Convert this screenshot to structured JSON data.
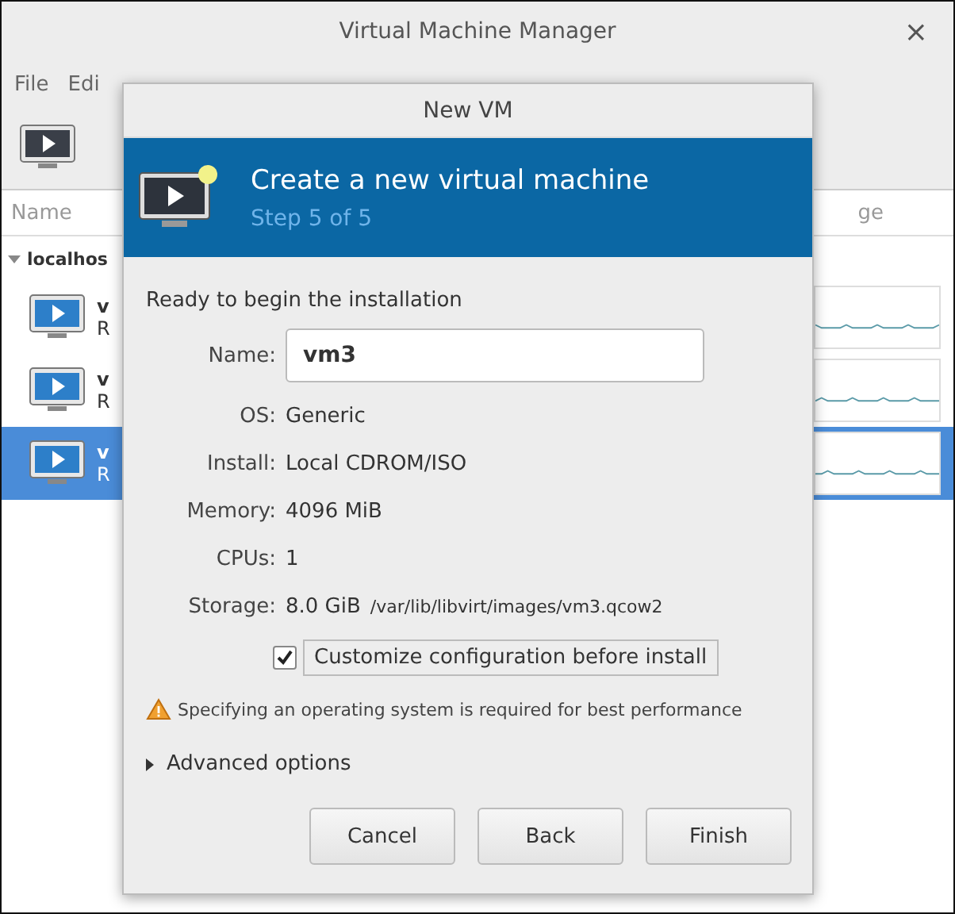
{
  "window": {
    "title": "Virtual Machine Manager",
    "close": "×"
  },
  "menu": [
    "File",
    "Edi"
  ],
  "columns": [
    "Name",
    "ge"
  ],
  "host": {
    "name": "localhos",
    "expanded": true
  },
  "vms": [
    {
      "name": "v",
      "status": "R",
      "selected": false
    },
    {
      "name": "v",
      "status": "R",
      "selected": false
    },
    {
      "name": "v",
      "status": "R",
      "selected": true
    }
  ],
  "dialog": {
    "title": "New VM",
    "heading": "Create a new virtual machine",
    "step": "Step 5 of 5",
    "intro": "Ready to begin the installation",
    "name": {
      "label": "Name:",
      "value": "vm3"
    },
    "details": [
      {
        "label": "OS:",
        "value": "Generic"
      },
      {
        "label": "Install:",
        "value": "Local CDROM/ISO"
      },
      {
        "label": "Memory:",
        "value": "4096 MiB"
      },
      {
        "label": "CPUs:",
        "value": "1"
      },
      {
        "label": "Storage:",
        "value": "8.0 GiB",
        "path": "/var/lib/libvirt/images/vm3.qcow2"
      }
    ],
    "customize": {
      "label": "Customize configuration before install",
      "checked": true
    },
    "warning": "Specifying an operating system is required for best performance",
    "advanced": {
      "label": "Advanced options",
      "expanded": false
    },
    "buttons": [
      "Cancel",
      "Back",
      "Finish"
    ]
  }
}
